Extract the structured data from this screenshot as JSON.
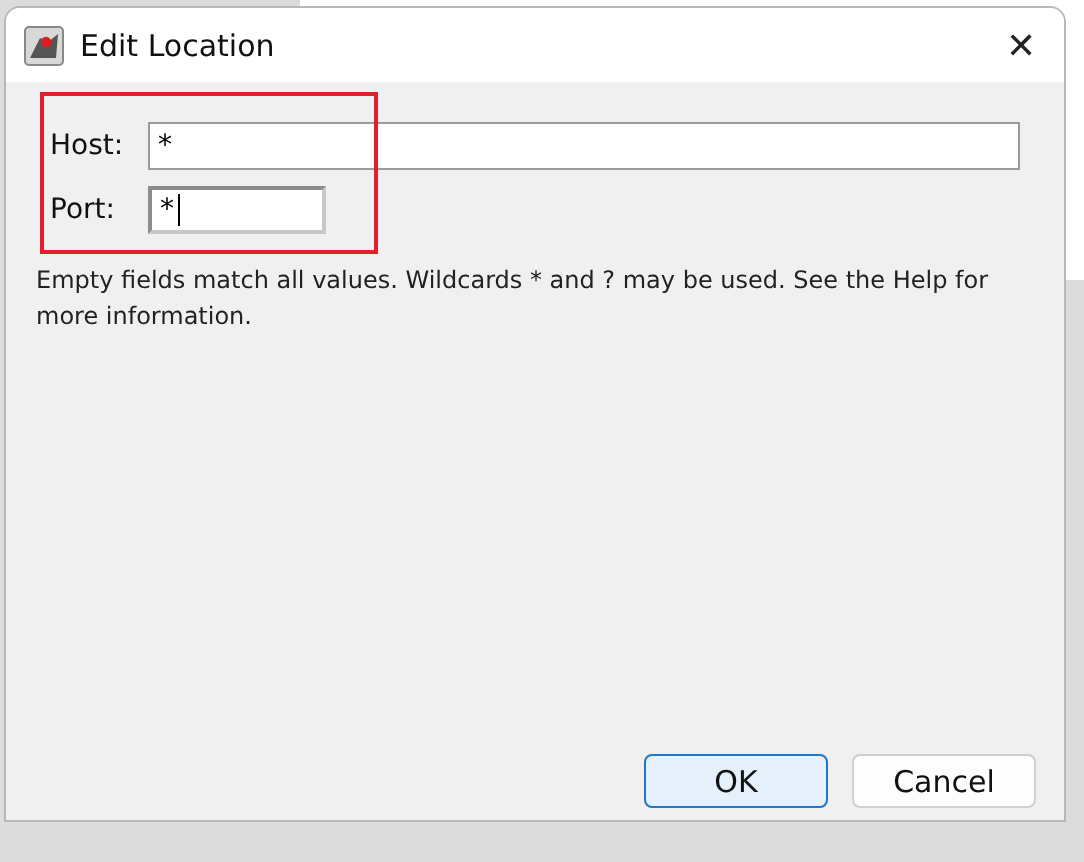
{
  "window": {
    "title": "Edit Location",
    "close": "✕"
  },
  "fields": [
    {
      "label": "Host:",
      "value": "*",
      "kind": "wide",
      "focused": false
    },
    {
      "label": "Port:",
      "value": "*",
      "kind": "narrow",
      "focused": true
    }
  ],
  "help_text": "Empty fields match all values. Wildcards * and ? may be used. See the Help for more information.",
  "buttons": [
    {
      "label": "OK",
      "default": true
    },
    {
      "label": "Cancel",
      "default": false
    }
  ]
}
